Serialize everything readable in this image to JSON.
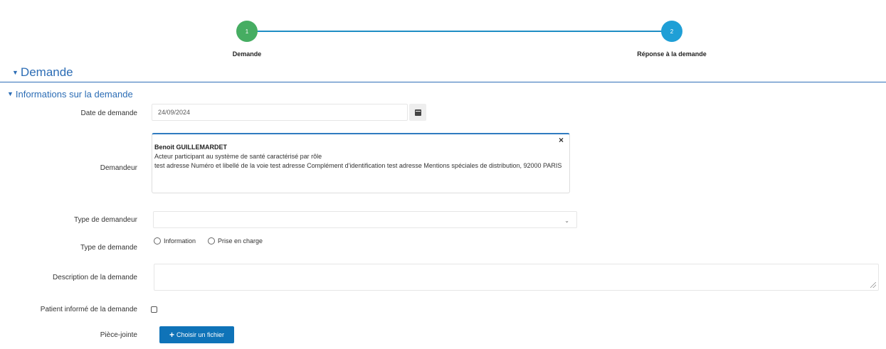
{
  "stepper": {
    "steps": [
      {
        "number": "1",
        "label": "Demande",
        "color": "#46ad62"
      },
      {
        "number": "2",
        "label": "Réponse à la demande",
        "color": "#1f9fd6"
      }
    ]
  },
  "section": {
    "title": "Demande"
  },
  "subsection": {
    "title": "Informations sur la demande"
  },
  "form": {
    "date": {
      "label": "Date de demande",
      "value": "24/09/2024"
    },
    "demandeur": {
      "label": "Demandeur",
      "name": "Benoit GUILLEMARDET",
      "role": "Acteur participant au système de santé caractérisé par rôle",
      "address": "test adresse Numéro et libellé de la voie test adresse Complément d'identification test adresse Mentions spéciales de distribution, 92000 PARIS"
    },
    "type_demandeur": {
      "label": "Type de demandeur",
      "value": ""
    },
    "type_demande": {
      "label": "Type de demande",
      "options": [
        "Information",
        "Prise en charge"
      ]
    },
    "description": {
      "label": "Description de la demande",
      "value": ""
    },
    "patient_informe": {
      "label": "Patient informé de la demande",
      "checked": false
    },
    "piece_jointe": {
      "label": "Pièce-jointe",
      "button": "Choisir un fichier"
    }
  },
  "icons": {
    "calendar": "calendar-icon",
    "close": "close-icon",
    "chevron": "chevron-down-icon",
    "plus": "plus-icon"
  }
}
